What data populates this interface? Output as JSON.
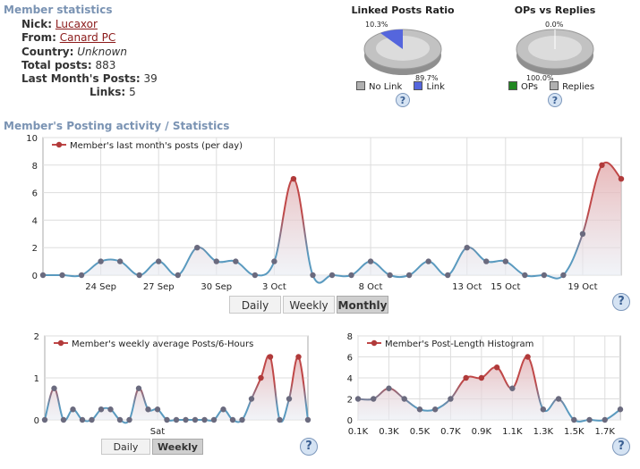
{
  "member": {
    "heading": "Member statistics",
    "nick_label": "Nick:",
    "nick_value": "Lucaxor",
    "from_label": "From:",
    "from_value": "Canard PC",
    "country_label": "Country:",
    "country_value": "Unknown",
    "total_label": "Total posts:",
    "total_value": "883",
    "lastmonth_label": "Last Month's Posts:",
    "lastmonth_value": "39",
    "links_label": "Links:",
    "links_value": "5"
  },
  "activity_heading": "Member's Posting activity / Statistics",
  "help_label": "?",
  "pie_linked": {
    "title": "Linked Posts Ratio",
    "slices": [
      {
        "label": "No Link",
        "value": 89.7,
        "color": "#b0b0b0"
      },
      {
        "label": "Link",
        "value": 10.3,
        "color": "#5566dd"
      }
    ],
    "label_top": "10.3%",
    "label_bottom": "89.7%",
    "legend_no_link": "No Link",
    "legend_link": "Link"
  },
  "pie_ops": {
    "title": "OPs vs Replies",
    "slices": [
      {
        "label": "OPs",
        "value": 0.0,
        "color": "#228822"
      },
      {
        "label": "Replies",
        "value": 100.0,
        "color": "#b0b0b0"
      }
    ],
    "label_top": "0.0%",
    "label_bottom": "100.0%",
    "legend_ops": "OPs",
    "legend_replies": "Replies"
  },
  "buttons": {
    "daily": "Daily",
    "weekly": "Weekly",
    "monthly": "Monthly"
  },
  "colors": {
    "line": "#5a9abf",
    "hot_line": "#c04848",
    "point": "#6a6a7e",
    "hot_point": "#b03a3a",
    "fill_top": "#e29a9a",
    "fill_bottom": "#e8ecf3"
  },
  "chart_data": [
    {
      "type": "area",
      "legend": "Member's last month's posts (per day)",
      "ylim": [
        0,
        10
      ],
      "yticks": [
        0,
        2,
        4,
        6,
        8,
        10
      ],
      "values": [
        0,
        0,
        0,
        1,
        1,
        0,
        1,
        0,
        2,
        1,
        1,
        0,
        1,
        7,
        0,
        0,
        0,
        1,
        0,
        0,
        1,
        0,
        2,
        1,
        1,
        0,
        0,
        0,
        3,
        8,
        7
      ],
      "tick_labels": [
        {
          "i": 3,
          "label": "24 Sep"
        },
        {
          "i": 6,
          "label": "27 Sep"
        },
        {
          "i": 9,
          "label": "30 Sep"
        },
        {
          "i": 12,
          "label": "3 Oct"
        },
        {
          "i": 17,
          "label": "8 Oct"
        },
        {
          "i": 22,
          "label": "13 Oct"
        },
        {
          "i": 24,
          "label": "15 Oct"
        },
        {
          "i": 28,
          "label": "19 Oct"
        }
      ],
      "grid": true
    },
    {
      "type": "area",
      "legend": "Member's weekly average Posts/6-Hours",
      "ylim": [
        0,
        2
      ],
      "yticks": [
        0,
        1,
        2
      ],
      "values": [
        0,
        0.75,
        0,
        0.25,
        0,
        0,
        0.25,
        0.25,
        0,
        0,
        0.75,
        0.25,
        0.25,
        0,
        0,
        0,
        0,
        0,
        0,
        0.25,
        0,
        0,
        0.5,
        1,
        1.5,
        0,
        0.5,
        1.5,
        0
      ],
      "tick_labels": [
        {
          "i": 12,
          "label": "Sat"
        }
      ],
      "grid": true
    },
    {
      "type": "area",
      "legend": "Member's Post-Length Histogram",
      "ylim": [
        0,
        8
      ],
      "yticks": [
        0,
        2,
        4,
        6,
        8
      ],
      "values": [
        2,
        2,
        3,
        2,
        1,
        1,
        2,
        4,
        4,
        5,
        3,
        6,
        1,
        2,
        0,
        0,
        0,
        1
      ],
      "tick_labels": [
        {
          "i": 0,
          "label": "0.1K"
        },
        {
          "i": 2,
          "label": "0.3K"
        },
        {
          "i": 4,
          "label": "0.5K"
        },
        {
          "i": 6,
          "label": "0.7K"
        },
        {
          "i": 8,
          "label": "0.9K"
        },
        {
          "i": 10,
          "label": "1.1K"
        },
        {
          "i": 12,
          "label": "1.3K"
        },
        {
          "i": 14,
          "label": "1.5K"
        },
        {
          "i": 16,
          "label": "1.7K"
        }
      ],
      "grid": true
    }
  ]
}
